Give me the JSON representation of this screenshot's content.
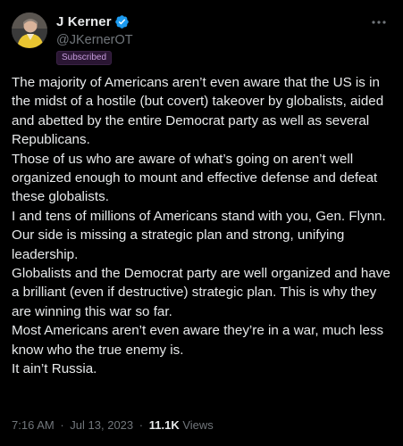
{
  "author": {
    "display_name": "J Kerner",
    "handle": "@JKernerOT",
    "badge": "Subscribed"
  },
  "post": {
    "paragraphs": [
      "The majority of Americans aren’t even aware that the US is in the midst of a hostile (but covert) takeover by globalists, aided and abetted by the entire Democrat party as well as several Republicans.",
      "Those of us who are aware of what’s going on aren’t well organized enough to mount and effective defense and defeat these globalists.",
      "I and tens of millions of Americans stand with you, Gen. Flynn.",
      "Our side is missing a strategic plan and strong, unifying leadership.",
      "Globalists and the Democrat party are well organized and have a brilliant (even if destructive) strategic plan. This is why they are winning this war so far.",
      "Most Americans aren’t even aware they’re in a war, much less know who the true enemy is.",
      "It ain’t Russia."
    ]
  },
  "meta": {
    "time": "7:16 AM",
    "separator": "·",
    "date": "Jul 13, 2023",
    "views_count": "11.1K",
    "views_label": "Views"
  },
  "icons": {
    "verified": "verified-badge-icon",
    "more": "more-options-icon"
  },
  "colors": {
    "background": "#000000",
    "text": "#e7e9ea",
    "secondary": "#71767b",
    "verified": "#1d9bf0",
    "badge": "#c59bdb"
  }
}
